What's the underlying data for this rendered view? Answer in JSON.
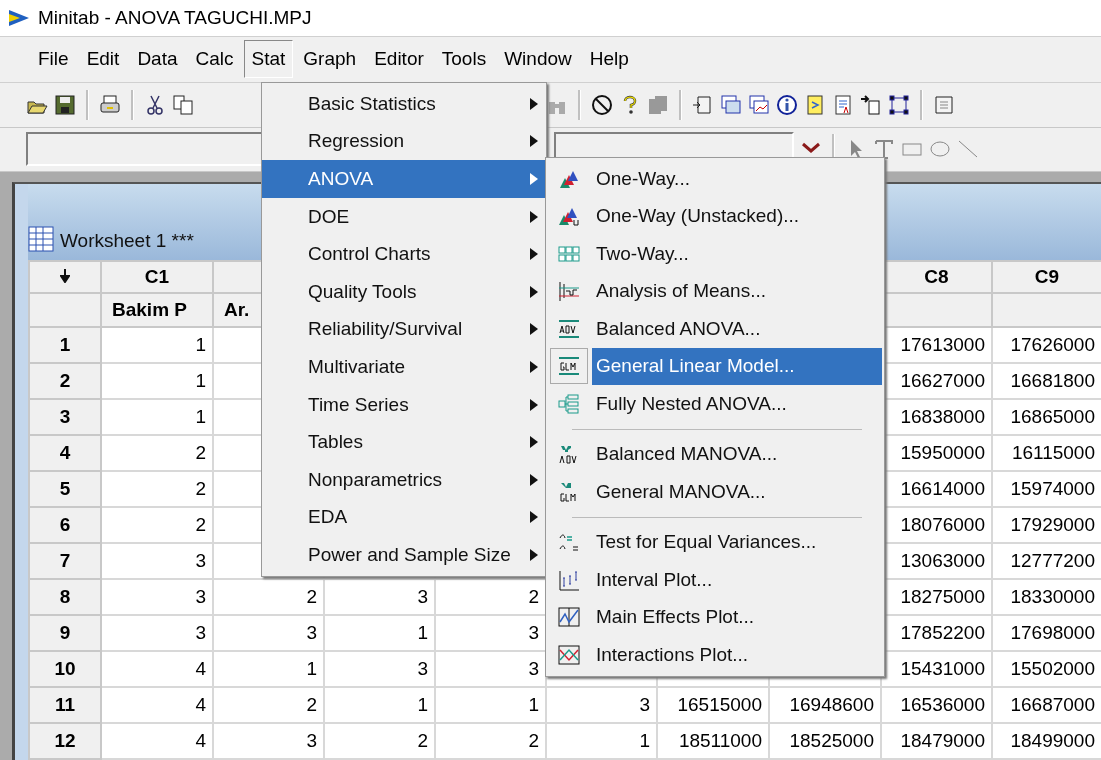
{
  "window": {
    "title": "Minitab - ANOVA TAGUCHI.MPJ"
  },
  "menu_bar": [
    {
      "label": "File",
      "selected": false
    },
    {
      "label": "Edit",
      "selected": false
    },
    {
      "label": "Data",
      "selected": false
    },
    {
      "label": "Calc",
      "selected": false
    },
    {
      "label": "Stat",
      "selected": true
    },
    {
      "label": "Graph",
      "selected": false
    },
    {
      "label": "Editor",
      "selected": false
    },
    {
      "label": "Tools",
      "selected": false
    },
    {
      "label": "Window",
      "selected": false
    },
    {
      "label": "Help",
      "selected": false
    }
  ],
  "worksheet": {
    "title": "Worksheet 1 ***",
    "columns": [
      {
        "header": "C1",
        "name": "Bakim P"
      },
      {
        "name": "Ar."
      },
      {},
      {},
      {},
      {},
      {},
      {
        "header": "C8"
      },
      {
        "header": "C9"
      }
    ],
    "rows": [
      {
        "number": "1",
        "cells": [
          "1",
          null,
          null,
          null,
          null,
          null,
          null,
          "17613000",
          "17626000"
        ]
      },
      {
        "number": "2",
        "cells": [
          "1",
          null,
          null,
          null,
          null,
          null,
          null,
          "16627000",
          "16681800"
        ]
      },
      {
        "number": "3",
        "cells": [
          "1",
          null,
          null,
          null,
          null,
          null,
          null,
          "16838000",
          "16865000"
        ]
      },
      {
        "number": "4",
        "cells": [
          "2",
          null,
          null,
          null,
          null,
          null,
          null,
          "15950000",
          "16115000"
        ]
      },
      {
        "number": "5",
        "cells": [
          "2",
          null,
          null,
          null,
          null,
          null,
          null,
          "16614000",
          "15974000"
        ]
      },
      {
        "number": "6",
        "cells": [
          "2",
          null,
          null,
          null,
          null,
          null,
          null,
          "18076000",
          "17929000"
        ]
      },
      {
        "number": "7",
        "cells": [
          "3",
          null,
          null,
          null,
          null,
          null,
          null,
          "13063000",
          "12777200"
        ]
      },
      {
        "number": "8",
        "cells": [
          "3",
          "2",
          "3",
          "2",
          null,
          null,
          null,
          "18275000",
          "18330000"
        ]
      },
      {
        "number": "9",
        "cells": [
          "3",
          "3",
          "1",
          "3",
          null,
          null,
          null,
          "17852200",
          "17698000"
        ]
      },
      {
        "number": "10",
        "cells": [
          "4",
          "1",
          "3",
          "3",
          null,
          null,
          null,
          "15431000",
          "15502000"
        ]
      },
      {
        "number": "11",
        "cells": [
          "4",
          "2",
          "1",
          "1",
          "3",
          "16515000",
          "16948600",
          "16536000",
          "16687000"
        ]
      },
      {
        "number": "12",
        "cells": [
          "4",
          "3",
          "2",
          "2",
          "1",
          "18511000",
          "18525000",
          "18479000",
          "18499000"
        ]
      }
    ]
  },
  "stat_menu": [
    {
      "label": "Basic Statistics",
      "selected": false
    },
    {
      "label": "Regression",
      "selected": false
    },
    {
      "label": "ANOVA",
      "selected": true
    },
    {
      "label": "DOE",
      "selected": false
    },
    {
      "label": "Control Charts",
      "selected": false
    },
    {
      "label": "Quality Tools",
      "selected": false
    },
    {
      "label": "Reliability/Survival",
      "selected": false
    },
    {
      "label": "Multivariate",
      "selected": false
    },
    {
      "label": "Time Series",
      "selected": false
    },
    {
      "label": "Tables",
      "selected": false
    },
    {
      "label": "Nonparametrics",
      "selected": false
    },
    {
      "label": "EDA",
      "selected": false
    },
    {
      "label": "Power and Sample Size",
      "selected": false
    }
  ],
  "anova_menu": [
    {
      "kind": "item",
      "label": "One-Way...",
      "selected": false
    },
    {
      "kind": "item",
      "label": "One-Way (Unstacked)...",
      "selected": false
    },
    {
      "kind": "item",
      "label": "Two-Way...",
      "selected": false
    },
    {
      "kind": "item",
      "label": "Analysis of Means...",
      "selected": false
    },
    {
      "kind": "item",
      "label": "Balanced ANOVA...",
      "selected": false
    },
    {
      "kind": "item",
      "label": "General Linear Model...",
      "selected": true
    },
    {
      "kind": "item",
      "label": "Fully Nested ANOVA...",
      "selected": false
    },
    {
      "kind": "separator"
    },
    {
      "kind": "item",
      "label": "Balanced MANOVA...",
      "selected": false
    },
    {
      "kind": "item",
      "label": "General MANOVA...",
      "selected": false
    },
    {
      "kind": "separator"
    },
    {
      "kind": "item",
      "label": "Test for Equal Variances...",
      "selected": false
    },
    {
      "kind": "item",
      "label": "Interval Plot...",
      "selected": false
    },
    {
      "kind": "item",
      "label": "Main Effects Plot...",
      "selected": false
    },
    {
      "kind": "item",
      "label": "Interactions Plot...",
      "selected": false
    }
  ]
}
